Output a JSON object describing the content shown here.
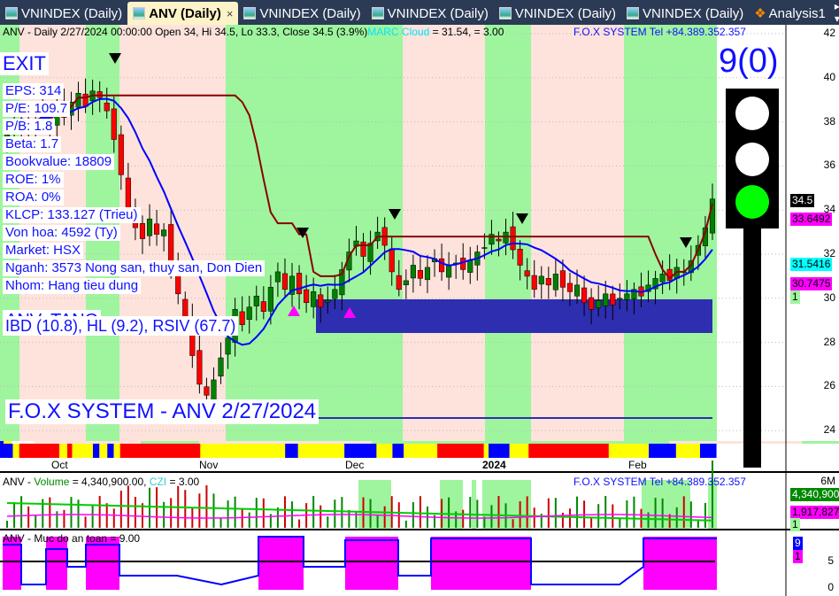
{
  "tabs": [
    {
      "label": "VNINDEX (Daily)"
    },
    {
      "label": "ANV (Daily)",
      "active": true
    },
    {
      "label": "VNINDEX (Daily)"
    },
    {
      "label": "VNINDEX (Daily)"
    },
    {
      "label": "VNINDEX (Daily)"
    },
    {
      "label": "VNINDEX (Daily)"
    },
    {
      "label": "Analysis1"
    }
  ],
  "tab_close": "×",
  "tab_nav": "◂ ▸ ▾",
  "price_pane": {
    "header_main": "ANV - Daily 2/27/2024 00:00:00 Open 34, Hi 34.5, Lo 33.3, Close 34.5 (3.9%)",
    "header_cloud": "MARC Cloud",
    "header_rest": " = 31.54,   = 3.00",
    "brand": "F.O.X SYSTEM Tel +84.389.352.357",
    "signal": "EXIT",
    "info": [
      "EPS: 314",
      "P/E: 109.7",
      "P/B: 1.8",
      "Beta: 1.7",
      "Bookvalue: 18809",
      "ROE: 1%",
      "ROA: 0%",
      "KLCP: 133.127 (Trieu)",
      "Von hoa: 4592 (Ty)",
      "Market: HSX",
      "Nganh: 3573 Nong san, thuy san, Don Dien",
      "Nhom: Hang tieu dung"
    ],
    "trend": "ANV: TANG",
    "indicators": "IBD (10.8), HL (9.2), RSIV (67.7)",
    "footer_title": "F.O.X SYSTEM - ANV 2/27/2024",
    "score": "9(0)",
    "y_ticks": [
      "42",
      "40",
      "38",
      "36",
      "34",
      "32",
      "30",
      "28",
      "26",
      "24"
    ],
    "tags": {
      "close": "34.5",
      "upper": "33.6492",
      "cloud": "31.5416",
      "lower": "30.7475",
      "count": "1"
    },
    "x_labels": [
      "Oct",
      "Nov",
      "Dec",
      "2024",
      "Feb"
    ],
    "closes": [
      37.6,
      37.8,
      38.1,
      37.5,
      37.9,
      38.4,
      38.0,
      38.6,
      38.2,
      38.9,
      39.3,
      38.7,
      39.4,
      39.1,
      38.5,
      37.2,
      35.6,
      34.1,
      33.2,
      32.7,
      33.6,
      32.9,
      33.1,
      31.4,
      30.2,
      29.1,
      27.4,
      26.1,
      25.6,
      26.3,
      27.3,
      28.2,
      29.5,
      28.8,
      29.6,
      30.1,
      29.4,
      30.5,
      31.2,
      30.4,
      31.0,
      30.2,
      29.8,
      30.3,
      29.6,
      29.9,
      30.4,
      31.3,
      32.1,
      32.6,
      31.9,
      32.5,
      33.0,
      32.4,
      31.2,
      30.4,
      30.8,
      31.5,
      30.9,
      31.4,
      31.8,
      31.2,
      31.5,
      31.6,
      31.3,
      31.7,
      32.1,
      32.3,
      32.9,
      32.6,
      33.0,
      32.2,
      31.5,
      31.0,
      30.4,
      31.0,
      30.6,
      31.1,
      30.5,
      30.3,
      30.6,
      29.8,
      29.5,
      29.9,
      30.2,
      29.7,
      30.0,
      30.2,
      30.4,
      30.1,
      30.6,
      30.9,
      31.1,
      30.8,
      31.4,
      31.2,
      31.7,
      32.4,
      33.2,
      34.5
    ],
    "colors": {
      "up": "#008000",
      "down": "#ff0000",
      "green_bg": "#9ef59e",
      "pink_bg": "#fde3dc"
    }
  },
  "volume_pane": {
    "header_name": "ANV - ",
    "header_vol": "Volume",
    "header_val": " = 4,340,900.00, ",
    "header_czi": "CZI",
    "header_czi_val": " = 3.00",
    "brand": "F.O.X SYSTEM Tel +84.389.352.357",
    "y_top": "6M",
    "tag_vol": "4,340,900",
    "tag_avg": "1,917,827",
    "tag_count": "1"
  },
  "safety_pane": {
    "header": "ANV - Muc do an toan = 9.00",
    "y_ticks": [
      "5",
      "0"
    ],
    "tag_val": "9",
    "tag_count": "1"
  }
}
